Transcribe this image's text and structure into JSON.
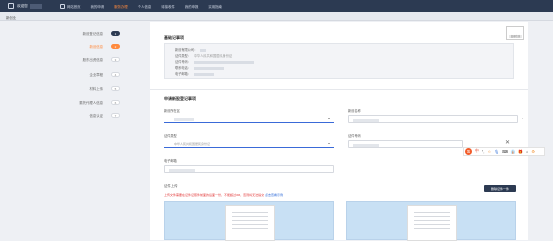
{
  "topbar": {
    "brand": "欢迎您",
    "nav": [
      "网站首页",
      "我的申请",
      "服务办理",
      "个人信息",
      "待接收件",
      "我的申报",
      "实用指南"
    ],
    "active_index": 2,
    "colors": {
      "bar": "#2c3a52",
      "active": "#ff8a3d"
    }
  },
  "breadcrumb": "新创业",
  "sidebar": {
    "steps": [
      {
        "label": "新设登记信息",
        "num": "1",
        "state": "done"
      },
      {
        "label": "新设信息",
        "num": "2",
        "state": "current"
      },
      {
        "label": "股东出资信息",
        "num": "3",
        "state": "todo"
      },
      {
        "label": "企业章程",
        "num": "4",
        "state": "todo"
      },
      {
        "label": "材料上传",
        "num": "5",
        "state": "todo"
      },
      {
        "label": "委托代理人信息",
        "num": "6",
        "state": "todo"
      },
      {
        "label": "信息认证",
        "num": "7",
        "state": "todo"
      }
    ]
  },
  "basic": {
    "title": "基础记事项",
    "rows": [
      "新设有限公司：",
      "证件类型：",
      "证件号码：",
      "联系电话：",
      "电子邮箱："
    ],
    "id_type_value": "中华人民共和国居民身份证",
    "stamp_button": "变更信息"
  },
  "form": {
    "title": "申请新股登记事项",
    "fields": {
      "region_label": "新设所在区",
      "company_label": "新设名称",
      "id_type_label": "证件类型",
      "id_type_value": "中华人民共和国居民身份证",
      "id_number_label": "证件号码",
      "email_label": "电子邮箱"
    }
  },
  "upload": {
    "title": "证件上传",
    "tip": "上传文件需要在证件证照件前面的后面一份，不能超过3M，否则将无法提交",
    "tip_link": "点击查看示例",
    "button": "删除证件一件"
  },
  "ime": {
    "logo": "S",
    "items": [
      "中",
      "°,",
      "☺",
      "🎙",
      "⌨",
      "👔",
      "🎁",
      "⌂",
      "⚙"
    ]
  },
  "close_symbol": "✕"
}
